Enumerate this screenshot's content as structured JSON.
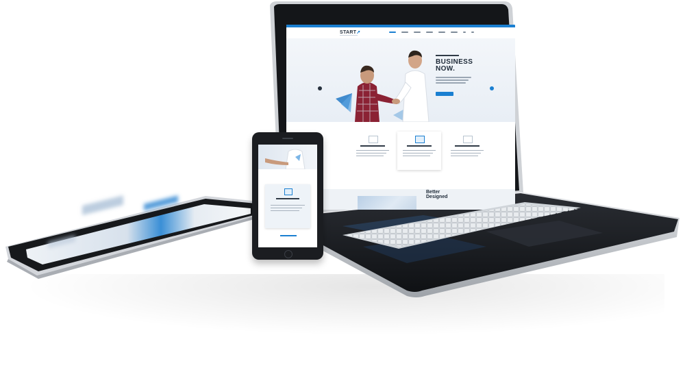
{
  "laptop_site": {
    "logo": "START",
    "logo_accent": "UP",
    "hero_title_line1": "BUSINESS",
    "hero_title_line2": "NOW.",
    "section_heading_line1": "Better",
    "section_heading_line2": "Designed"
  },
  "colors": {
    "accent": "#1a7fd1",
    "dark_text": "#1e2a38",
    "device_body": "#1b1d21",
    "device_frame": "#c9ccd1"
  },
  "icons": {
    "logo_mark": "arrow-up-icon",
    "hero_prev": "chevron-left-icon",
    "hero_next": "chevron-right-icon"
  }
}
